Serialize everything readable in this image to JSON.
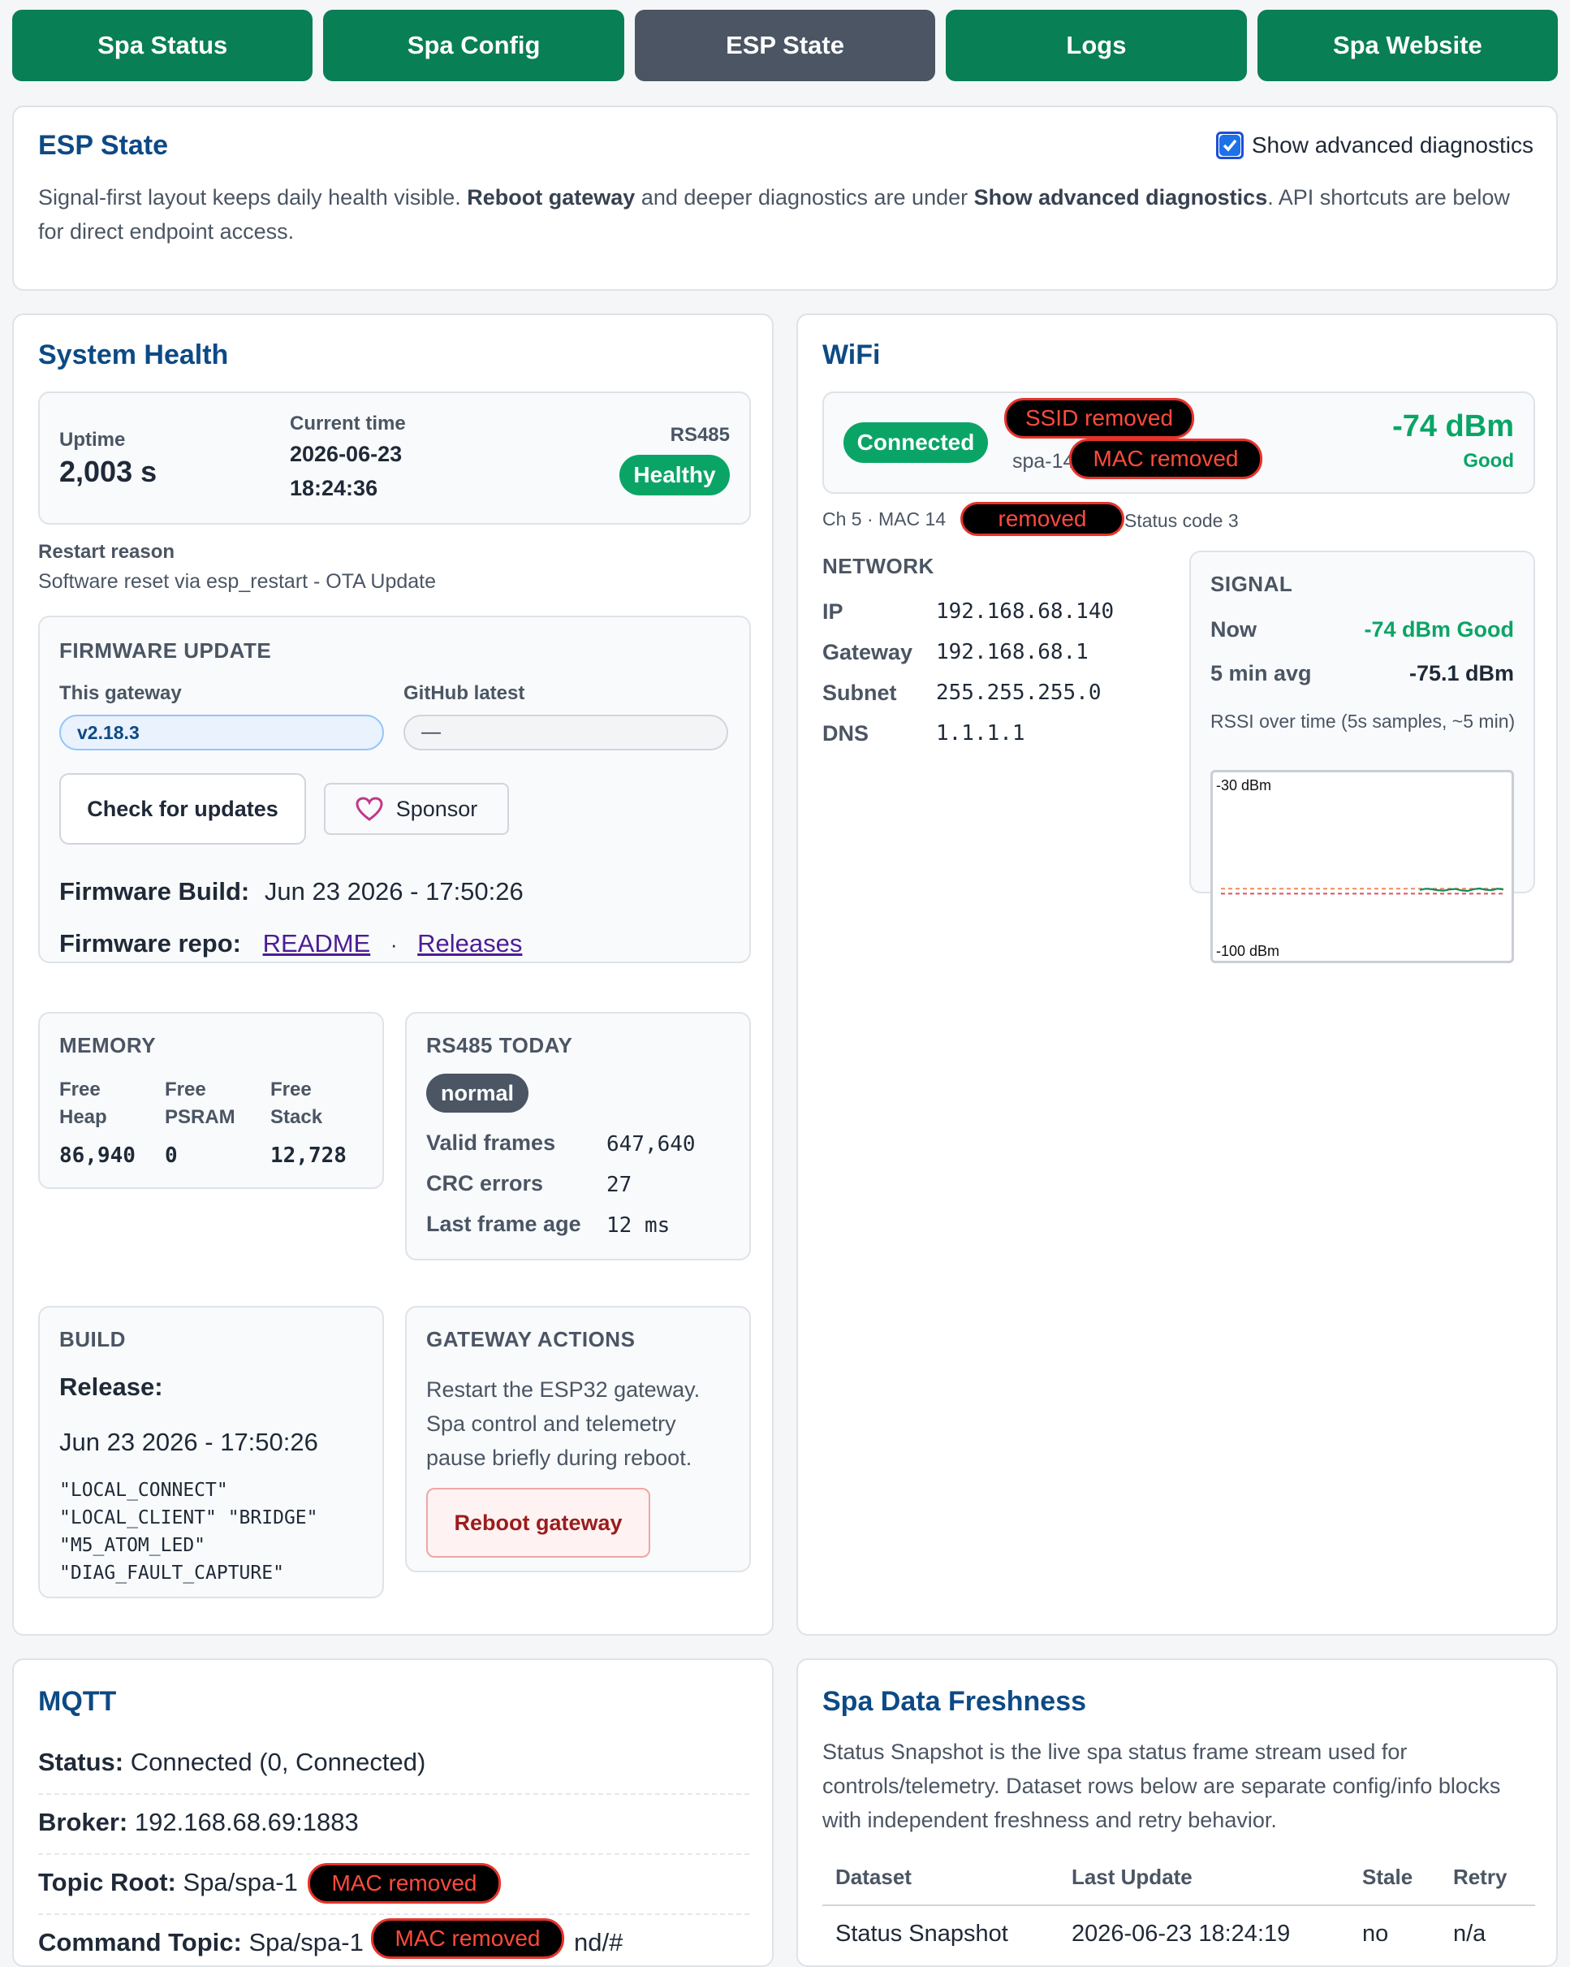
{
  "nav": {
    "tabs": [
      {
        "label": "Spa Status",
        "active": false
      },
      {
        "label": "Spa Config",
        "active": false
      },
      {
        "label": "ESP State",
        "active": true
      },
      {
        "label": "Logs",
        "active": false
      },
      {
        "label": "Spa Website",
        "active": false
      }
    ]
  },
  "header": {
    "title": "ESP State",
    "advanced_checkbox_label": "Show advanced diagnostics",
    "advanced_checked": true,
    "desc_part1": "Signal-first layout keeps daily health visible. ",
    "desc_bold1": "Reboot gateway",
    "desc_part2": " and deeper diagnostics are under ",
    "desc_bold2": "Show advanced diagnostics",
    "desc_part3": ". API shortcuts are below for direct endpoint access."
  },
  "system_health": {
    "title": "System Health",
    "uptime_label": "Uptime",
    "uptime_value": "2,003 s",
    "current_time_label": "Current time",
    "current_date": "2026-06-23",
    "current_clock": "18:24:36",
    "rs485_label": "RS485",
    "rs485_status": "Healthy",
    "restart_reason_label": "Restart reason",
    "restart_reason": "Software reset via esp_restart - OTA Update",
    "firmware": {
      "heading": "FIRMWARE UPDATE",
      "this_gateway_label": "This gateway",
      "this_gateway_value": "v2.18.3",
      "github_label": "GitHub latest",
      "github_value": "—",
      "check_button": "Check for updates",
      "sponsor_button": "Sponsor",
      "build_label": "Firmware Build:",
      "build_value": "Jun 23 2026 - 17:50:26",
      "repo_label": "Firmware repo:",
      "readme_link": "README",
      "sep": "·",
      "releases_link": "Releases"
    },
    "memory": {
      "heading": "MEMORY",
      "cols": [
        {
          "label1": "Free",
          "label2": "Heap",
          "value": "86,940"
        },
        {
          "label1": "Free",
          "label2": "PSRAM",
          "value": "0"
        },
        {
          "label1": "Free",
          "label2": "Stack",
          "value": "12,728"
        }
      ]
    },
    "rs485_today": {
      "heading": "RS485 TODAY",
      "mode": "normal",
      "rows": [
        {
          "label": "Valid frames",
          "value": "647,640"
        },
        {
          "label": "CRC errors",
          "value": "27"
        },
        {
          "label": "Last frame age",
          "value": "12 ms"
        }
      ]
    },
    "build": {
      "heading": "BUILD",
      "release_label": "Release:",
      "release_value": "Jun 23 2026 - 17:50:26",
      "flags": [
        "\"LOCAL_CONNECT\"",
        "\"LOCAL_CLIENT\" \"BRIDGE\"",
        "\"M5_ATOM_LED\"",
        "\"DIAG_FAULT_CAPTURE\""
      ]
    },
    "gateway_actions": {
      "heading": "GATEWAY ACTIONS",
      "description": "Restart the ESP32 gateway. Spa control and telemetry pause briefly during reboot.",
      "reboot_button": "Reboot gateway"
    }
  },
  "wifi": {
    "title": "WiFi",
    "status": "Connected",
    "ssid_redacted": "SSID removed",
    "host_prefix": "spa-14",
    "mac_redacted": "MAC removed",
    "rssi": "-74 dBm",
    "quality": "Good",
    "ch_line_prefix": "Ch 5 · MAC 14",
    "ch_line_redacted": "removed",
    "ch_line_suffix": "Status code 3",
    "network": {
      "heading": "NETWORK",
      "rows": [
        {
          "label": "IP",
          "value": "192.168.68.140"
        },
        {
          "label": "Gateway",
          "value": "192.168.68.1"
        },
        {
          "label": "Subnet",
          "value": "255.255.255.0"
        },
        {
          "label": "DNS",
          "value": "1.1.1.1"
        }
      ]
    },
    "signal": {
      "heading": "SIGNAL",
      "now_label": "Now",
      "now_value": "-74 dBm Good",
      "avg_label": "5 min avg",
      "avg_value": "-75.1 dBm",
      "rssi_caption": "RSSI over time (5s samples, ~5 min)",
      "top_label": "-30 dBm",
      "bottom_label": "-100 dBm"
    }
  },
  "chart_data": {
    "type": "line",
    "title": "",
    "ylim": [
      -100,
      -30
    ],
    "series": [
      {
        "values": [
          -74.5,
          -74.0,
          -74.2,
          -74.6,
          -74.8,
          -74.3,
          -74.1,
          -74.7,
          -74.9,
          -74.2,
          -73.9,
          -74.4,
          -74.6,
          -74.0,
          -74.3
        ]
      }
    ],
    "reference_lines": [
      -74,
      -76
    ],
    "grid": false
  },
  "mqtt": {
    "title": "MQTT",
    "status_label": "Status:",
    "status_value": "Connected (0, Connected)",
    "broker_label": "Broker:",
    "broker_value": "192.168.68.69:1883",
    "topic_label": "Topic Root:",
    "topic_value": "Spa/spa-1",
    "topic_redacted": "MAC removed",
    "command_label": "Command Topic:",
    "command_value": "Spa/spa-1",
    "command_redacted": "MAC removed",
    "command_suffix": "nd/#"
  },
  "freshness": {
    "title": "Spa Data Freshness",
    "description": "Status Snapshot is the live spa status frame stream used for controls/telemetry. Dataset rows below are separate config/info blocks with independent freshness and retry behavior.",
    "columns": [
      "Dataset",
      "Last Update",
      "Stale",
      "Retry"
    ],
    "rows": [
      {
        "dataset": "Status Snapshot",
        "last_update": "2026-06-23 18:24:19",
        "stale": "no",
        "retry": "n/a"
      }
    ]
  },
  "colors": {
    "nav_green": "#087f55",
    "nav_active": "#4b5563",
    "heading_blue": "#0c4a85",
    "good_green": "#0aa566"
  }
}
